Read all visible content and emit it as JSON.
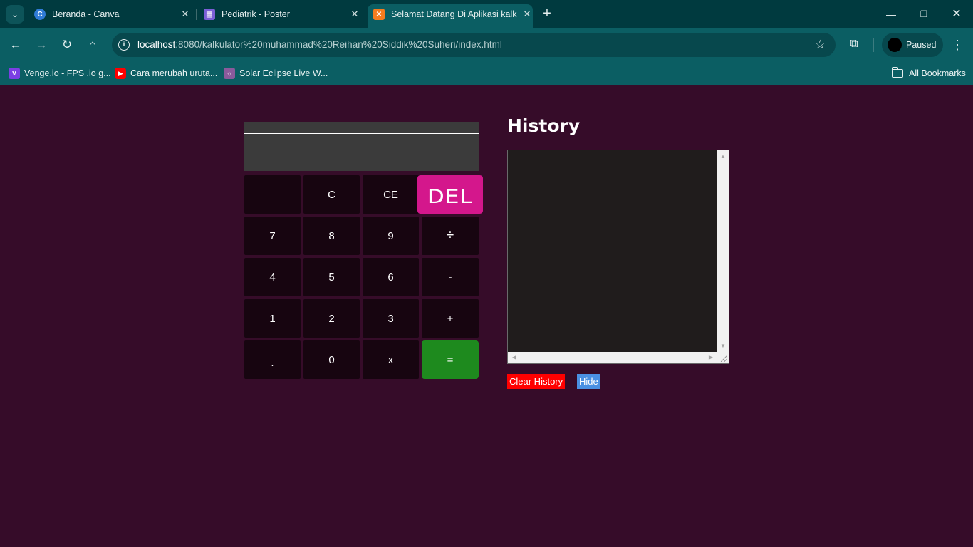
{
  "browser": {
    "tabs": [
      {
        "title": "Beranda - Canva",
        "active": false
      },
      {
        "title": "Pediatrik - Poster",
        "active": false
      },
      {
        "title": "Selamat Datang Di Aplikasi kalk",
        "active": true
      }
    ],
    "url_host": "localhost",
    "url_path": ":8080/kalkulator%20muhammad%20Reihan%20Siddik%20Suheri/index.html",
    "profile_label": "Paused",
    "bookmarks": [
      {
        "label": "Venge.io - FPS .io g..."
      },
      {
        "label": "Cara merubah uruta..."
      },
      {
        "label": "Solar Eclipse Live W..."
      }
    ],
    "all_bookmarks_label": "All Bookmarks"
  },
  "calculator": {
    "display_expression": "",
    "display_value": "",
    "keys": [
      "",
      "C",
      "CE",
      "DEL",
      "7",
      "8",
      "9",
      "÷",
      "4",
      "5",
      "6",
      "-",
      "1",
      "2",
      "3",
      "+",
      ".",
      "0",
      "x",
      "="
    ],
    "colors": {
      "del": "#d4178c",
      "equals": "#1e8a1e",
      "key": "#170510",
      "display": "#3b3b3b"
    }
  },
  "history": {
    "title": "History",
    "content": "",
    "clear_label": "Clear History",
    "hide_label": "Hide"
  },
  "colors": {
    "page_bg": "#360c29",
    "chrome": "#0b5e63",
    "tabstrip": "#003a3f"
  }
}
